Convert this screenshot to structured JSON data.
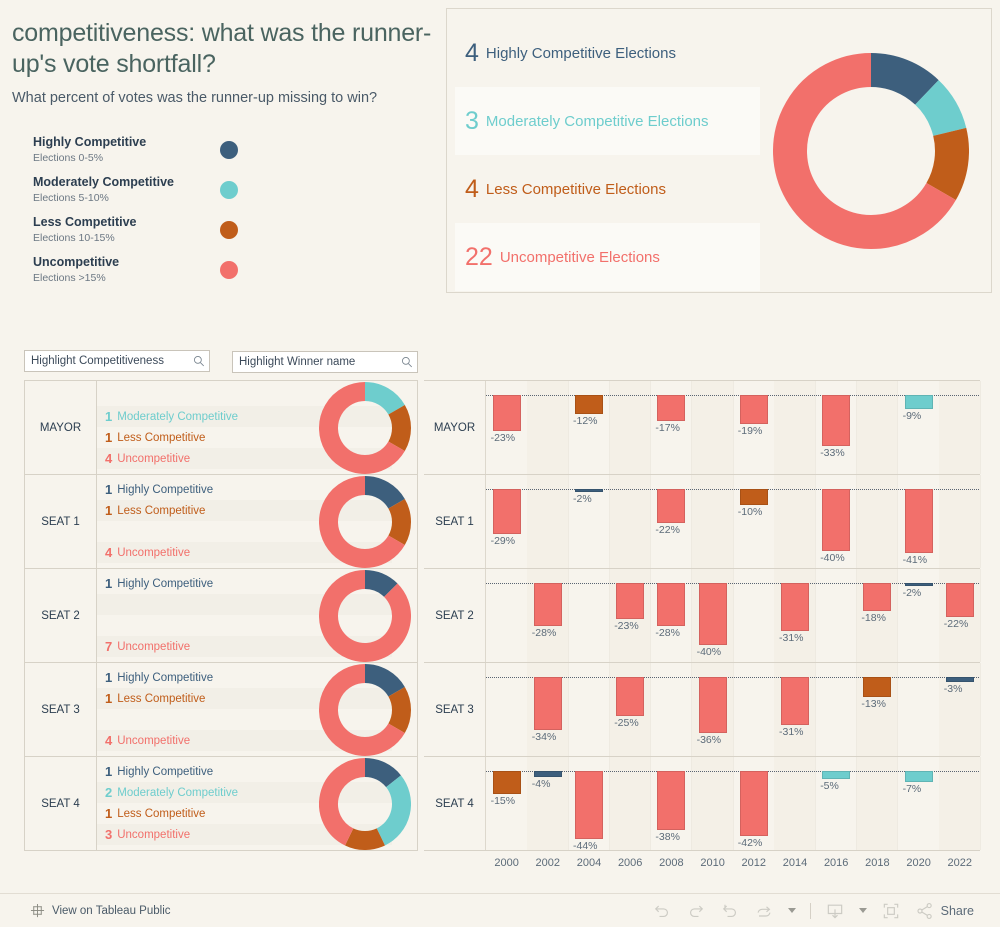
{
  "header": {
    "title": "competitiveness: what was the runner-up's vote shortfall?",
    "subtitle": "What percent of votes was the runner-up missing to win?"
  },
  "colors": {
    "highly": "#3d5f7d",
    "moderately": "#6ecdcd",
    "less": "#c05d1a",
    "uncompetitive": "#f2706b",
    "background": "#f7f4ed",
    "text": "#3c4a5a"
  },
  "legend": {
    "items": [
      {
        "name": "Highly Competitive",
        "range": "Elections 0-5%",
        "color_key": "highly"
      },
      {
        "name": "Moderately Competitive",
        "range": "Elections 5-10%",
        "color_key": "moderately"
      },
      {
        "name": "Less Competitive",
        "range": "Elections 10-15%",
        "color_key": "less"
      },
      {
        "name": "Uncompetitive",
        "range": "Elections >15%",
        "color_key": "uncompetitive"
      }
    ]
  },
  "summary": {
    "rows": [
      {
        "count": "4",
        "label": "Highly Competitive Elections",
        "color_key": "highly"
      },
      {
        "count": "3",
        "label": "Moderately Competitive Elections",
        "color_key": "moderately"
      },
      {
        "count": "4",
        "label": "Less Competitive Elections",
        "color_key": "less"
      },
      {
        "count": "22",
        "label": "Uncompetitive Elections",
        "color_key": "uncompetitive"
      }
    ]
  },
  "filters": {
    "competitiveness_placeholder": "Highlight Competitiveness",
    "competitiveness_value": "",
    "winner_placeholder": "Highlight Winner name",
    "winner_value": ""
  },
  "table": {
    "rows": [
      {
        "seat": "MAYOR",
        "categories": [
          {
            "count": "",
            "label": "",
            "color_key": "highly",
            "shade": false
          },
          {
            "count": "1",
            "label": "Moderately Competitive",
            "color_key": "moderately",
            "shade": true
          },
          {
            "count": "1",
            "label": "Less Competitive",
            "color_key": "less",
            "shade": false
          },
          {
            "count": "4",
            "label": "Uncompetitive",
            "color_key": "uncompetitive",
            "shade": true
          }
        ],
        "donut": [
          0,
          1,
          1,
          4
        ]
      },
      {
        "seat": "SEAT 1",
        "categories": [
          {
            "count": "1",
            "label": "Highly Competitive",
            "color_key": "highly",
            "shade": false
          },
          {
            "count": "1",
            "label": "Less Competitive",
            "color_key": "less",
            "shade": true
          },
          {
            "count": "",
            "label": "",
            "color_key": "moderately",
            "shade": false
          },
          {
            "count": "4",
            "label": "Uncompetitive",
            "color_key": "uncompetitive",
            "shade": true
          }
        ],
        "donut": [
          1,
          0,
          1,
          4
        ]
      },
      {
        "seat": "SEAT 2",
        "categories": [
          {
            "count": "1",
            "label": "Highly Competitive",
            "color_key": "highly",
            "shade": false
          },
          {
            "count": "",
            "label": "",
            "color_key": "moderately",
            "shade": true
          },
          {
            "count": "",
            "label": "",
            "color_key": "less",
            "shade": false
          },
          {
            "count": "7",
            "label": "Uncompetitive",
            "color_key": "uncompetitive",
            "shade": true
          }
        ],
        "donut": [
          1,
          0,
          0,
          7
        ]
      },
      {
        "seat": "SEAT 3",
        "categories": [
          {
            "count": "1",
            "label": "Highly Competitive",
            "color_key": "highly",
            "shade": false
          },
          {
            "count": "1",
            "label": "Less Competitive",
            "color_key": "less",
            "shade": true
          },
          {
            "count": "",
            "label": "",
            "color_key": "moderately",
            "shade": false
          },
          {
            "count": "4",
            "label": "Uncompetitive",
            "color_key": "uncompetitive",
            "shade": true
          }
        ],
        "donut": [
          1,
          0,
          1,
          4
        ]
      },
      {
        "seat": "SEAT 4",
        "categories": [
          {
            "count": "1",
            "label": "Highly Competitive",
            "color_key": "highly",
            "shade": false
          },
          {
            "count": "2",
            "label": "Moderately Competitive",
            "color_key": "moderately",
            "shade": true
          },
          {
            "count": "1",
            "label": "Less Competitive",
            "color_key": "less",
            "shade": false
          },
          {
            "count": "3",
            "label": "Uncompetitive",
            "color_key": "uncompetitive",
            "shade": true
          }
        ],
        "donut": [
          1,
          2,
          1,
          3
        ]
      }
    ]
  },
  "chart_data": {
    "type": "bar",
    "title": "competitiveness: what was the runner-up's vote shortfall?",
    "subtitle": "What percent of votes was the runner-up missing to win?",
    "xlabel": "",
    "ylabel": "",
    "ylim": [
      -50,
      0
    ],
    "grid": true,
    "x": [
      2000,
      2002,
      2004,
      2006,
      2008,
      2010,
      2012,
      2014,
      2016,
      2018,
      2020,
      2022
    ],
    "tick_labels": [
      "2000",
      "2002",
      "2004",
      "2006",
      "2008",
      "2010",
      "2012",
      "2014",
      "2016",
      "2018",
      "2020",
      "2022"
    ],
    "legend": [
      "Highly Competitive",
      "Moderately Competitive",
      "Less Competitive",
      "Uncompetitive"
    ],
    "series": [
      {
        "name": "MAYOR",
        "points": [
          {
            "year": 2000,
            "value": -23,
            "label": "-23%",
            "color_key": "uncompetitive"
          },
          {
            "year": 2004,
            "value": -12,
            "label": "-12%",
            "color_key": "less"
          },
          {
            "year": 2008,
            "value": -17,
            "label": "-17%",
            "color_key": "uncompetitive"
          },
          {
            "year": 2012,
            "value": -19,
            "label": "-19%",
            "color_key": "uncompetitive"
          },
          {
            "year": 2016,
            "value": -33,
            "label": "-33%",
            "color_key": "uncompetitive"
          },
          {
            "year": 2020,
            "value": -9,
            "label": "-9%",
            "color_key": "moderately"
          }
        ]
      },
      {
        "name": "SEAT 1",
        "points": [
          {
            "year": 2000,
            "value": -29,
            "label": "-29%",
            "color_key": "uncompetitive"
          },
          {
            "year": 2004,
            "value": -2,
            "label": "-2%",
            "color_key": "highly"
          },
          {
            "year": 2008,
            "value": -22,
            "label": "-22%",
            "color_key": "uncompetitive"
          },
          {
            "year": 2012,
            "value": -10,
            "label": "-10%",
            "color_key": "less"
          },
          {
            "year": 2016,
            "value": -40,
            "label": "-40%",
            "color_key": "uncompetitive"
          },
          {
            "year": 2020,
            "value": -41,
            "label": "-41%",
            "color_key": "uncompetitive"
          }
        ]
      },
      {
        "name": "SEAT 2",
        "points": [
          {
            "year": 2002,
            "value": -28,
            "label": "-28%",
            "color_key": "uncompetitive"
          },
          {
            "year": 2006,
            "value": -23,
            "label": "-23%",
            "color_key": "uncompetitive"
          },
          {
            "year": 2008,
            "value": -28,
            "label": "-28%",
            "color_key": "uncompetitive"
          },
          {
            "year": 2010,
            "value": -40,
            "label": "-40%",
            "color_key": "uncompetitive"
          },
          {
            "year": 2014,
            "value": -31,
            "label": "-31%",
            "color_key": "uncompetitive"
          },
          {
            "year": 2018,
            "value": -18,
            "label": "-18%",
            "color_key": "uncompetitive"
          },
          {
            "year": 2020,
            "value": -2,
            "label": "-2%",
            "color_key": "highly"
          },
          {
            "year": 2022,
            "value": -22,
            "label": "-22%",
            "color_key": "uncompetitive"
          }
        ]
      },
      {
        "name": "SEAT 3",
        "points": [
          {
            "year": 2002,
            "value": -34,
            "label": "-34%",
            "color_key": "uncompetitive"
          },
          {
            "year": 2006,
            "value": -25,
            "label": "-25%",
            "color_key": "uncompetitive"
          },
          {
            "year": 2010,
            "value": -36,
            "label": "-36%",
            "color_key": "uncompetitive"
          },
          {
            "year": 2014,
            "value": -31,
            "label": "-31%",
            "color_key": "uncompetitive"
          },
          {
            "year": 2018,
            "value": -13,
            "label": "-13%",
            "color_key": "less"
          },
          {
            "year": 2022,
            "value": -3,
            "label": "-3%",
            "color_key": "highly"
          }
        ]
      },
      {
        "name": "SEAT 4",
        "points": [
          {
            "year": 2000,
            "value": -15,
            "label": "-15%",
            "color_key": "less"
          },
          {
            "year": 2002,
            "value": -4,
            "label": "-4%",
            "color_key": "highly"
          },
          {
            "year": 2004,
            "value": -44,
            "label": "-44%",
            "color_key": "uncompetitive"
          },
          {
            "year": 2008,
            "value": -38,
            "label": "-38%",
            "color_key": "uncompetitive"
          },
          {
            "year": 2012,
            "value": -42,
            "label": "-42%",
            "color_key": "uncompetitive"
          },
          {
            "year": 2016,
            "value": -5,
            "label": "-5%",
            "color_key": "moderately"
          },
          {
            "year": 2020,
            "value": -7,
            "label": "-7%",
            "color_key": "moderately"
          }
        ]
      }
    ],
    "donut_summary": {
      "type": "pie",
      "categories": [
        "Highly Competitive",
        "Moderately Competitive",
        "Less Competitive",
        "Uncompetitive"
      ],
      "values": [
        4,
        3,
        4,
        22
      ],
      "total": 33
    }
  },
  "toolbar": {
    "tableau_public_label": "View on Tableau Public",
    "share_label": "Share",
    "undo_icon": "undo-icon",
    "redo_icon": "redo-icon",
    "revert_icon": "revert-icon",
    "refresh_icon": "refresh-icon",
    "download_icon": "download-icon",
    "fullscreen_icon": "fullscreen-icon",
    "share_icon": "share-icon"
  }
}
